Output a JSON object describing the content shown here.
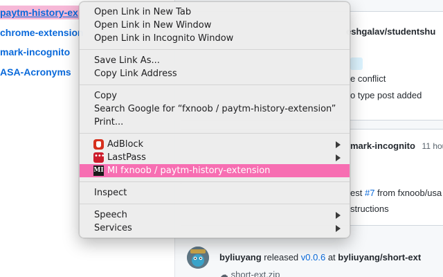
{
  "repo_list": [
    "paytm-history-ex",
    "chrome-extension",
    "mark-incognito",
    "ASA-Acronyms"
  ],
  "feed": {
    "card1_repo": "eshgalav/studentshu",
    "card1_line1": "e conflict",
    "card1_line2": "o type post added",
    "card2_repo": "mark-incognito",
    "card2_time": "11 hou",
    "card2_line1_prefix": "est ",
    "card2_line1_issue": "#7",
    "card2_line1_suffix": " from fxnoob/usa",
    "card2_line2": "structions",
    "card3_user": "byliuyang",
    "card3_action": " released ",
    "card3_version": "v0.0.6",
    "card3_at": " at ",
    "card3_repo": "byliuyang/short-ext",
    "card3_asset": "short-ext.zip"
  },
  "context_menu": {
    "group1": [
      "Open Link in New Tab",
      "Open Link in New Window",
      "Open Link in Incognito Window"
    ],
    "group2": [
      "Save Link As...",
      "Copy Link Address"
    ],
    "group3": [
      "Copy",
      "Search Google for “fxnoob / paytm-history-extension”",
      "Print..."
    ],
    "extensions": [
      {
        "label": "AdBlock",
        "icon": "adblock-icon",
        "submenu": true
      },
      {
        "label": "LastPass",
        "icon": "lastpass-icon",
        "submenu": true
      },
      {
        "label": "MI fxnoob / paytm-history-extension",
        "icon": "mi-icon",
        "submenu": false,
        "active": true
      }
    ],
    "mi_icon_text": "MI",
    "group5": [
      "Inspect"
    ],
    "group6": [
      {
        "label": "Speech",
        "submenu": true
      },
      {
        "label": "Services",
        "submenu": true
      }
    ],
    "active_color": "#f76eb2"
  },
  "colors": {
    "link_blue": "#0969da",
    "highlight_pink": "#f6b8d7"
  }
}
